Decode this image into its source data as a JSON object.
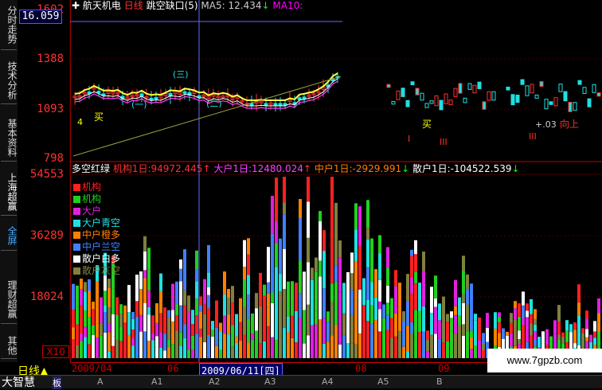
{
  "side_tabs": [
    {
      "label": "分时走势"
    },
    {
      "label": "技术分析"
    },
    {
      "label": "基本资料"
    },
    {
      "label": "上海超赢"
    },
    {
      "label": "全屏"
    },
    {
      "label": "理财超赢"
    },
    {
      "label": "其他"
    }
  ],
  "price_box": "16.059",
  "header": {
    "stock": "航天机电",
    "period": "日线",
    "indicator": "跳空缺口(5)",
    "ma5_label": "MA5:",
    "ma5_value": "12.434",
    "ma10_label": "MA10:"
  },
  "price_axis": [
    "1602",
    "1388",
    "1093",
    "798"
  ],
  "volume_header": {
    "title": "多空红绿",
    "inst_label": "机构1日:",
    "inst_value": "94972.445",
    "big_label": "大户1日:",
    "big_value": "12480.024",
    "mid_label": "中户1日:",
    "mid_value": "-2929.991",
    "small_label": "散户1日:",
    "small_value": "-104522.539"
  },
  "volume_axis": [
    "54553",
    "36289",
    "18024"
  ],
  "legend": [
    {
      "label": "机构",
      "color": "#ff2020"
    },
    {
      "label": "机构",
      "color": "#20d020"
    },
    {
      "label": "大户",
      "color": "#e020e0"
    },
    {
      "label": "大户青空",
      "color": "#20e0e0"
    },
    {
      "label": "中户橙多",
      "color": "#ff8000"
    },
    {
      "label": "中户兰空",
      "color": "#4080ff"
    },
    {
      "label": "散户白多",
      "color": "#ffffff"
    },
    {
      "label": "散户灰空",
      "color": "#808040"
    }
  ],
  "annotations": {
    "buy1": "买",
    "buy2": "买",
    "up": "向上",
    "inc": "+.03",
    "nums": [
      "4",
      "I",
      "III",
      "III",
      "(一)",
      "(三)",
      "(二)"
    ]
  },
  "multiplier": "X10",
  "date_axis": {
    "d1": "2009/04",
    "d2": "06",
    "cursor_date": "2009/06/11[四]",
    "d3": "08",
    "d4": "09"
  },
  "period_tab": "日线",
  "brand": "大智慧",
  "bottom_tabs": [
    "板",
    "A",
    "A1",
    "A2",
    "A3",
    "A4",
    "A5",
    "B"
  ],
  "watermark": "www.7gpzb.com",
  "chart_data": {
    "type": "bar",
    "volume_series_colors": [
      "#ff2020",
      "#20d020",
      "#20e0e0",
      "#ff8000",
      "#4080ff",
      "#ffffff",
      "#808040",
      "#e020e0"
    ]
  }
}
